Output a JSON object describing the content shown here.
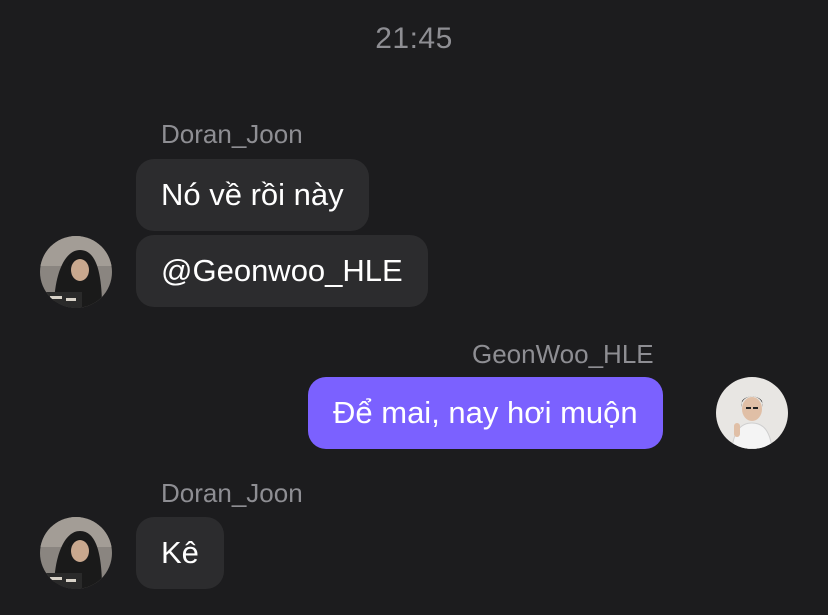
{
  "chat": {
    "timestamp": "21:45",
    "groups": [
      {
        "sender": "Doran_Joon",
        "direction": "incoming",
        "avatar_icon": "user-avatar-hoodie-icon",
        "messages": [
          "Nó về rồi này",
          "@Geonwoo_HLE"
        ]
      },
      {
        "sender": "GeonWoo_HLE",
        "direction": "outgoing",
        "avatar_icon": "user-avatar-portrait-icon",
        "messages": [
          "Để mai, nay hơi muộn"
        ]
      },
      {
        "sender": "Doran_Joon",
        "direction": "incoming",
        "avatar_icon": "user-avatar-hoodie-icon",
        "messages": [
          "Kê"
        ]
      }
    ]
  },
  "colors": {
    "background": "#1c1c1e",
    "incoming_bubble": "#2c2c2e",
    "outgoing_bubble": "#7b61ff",
    "meta_text": "#8e8e93",
    "message_text": "#ffffff"
  }
}
